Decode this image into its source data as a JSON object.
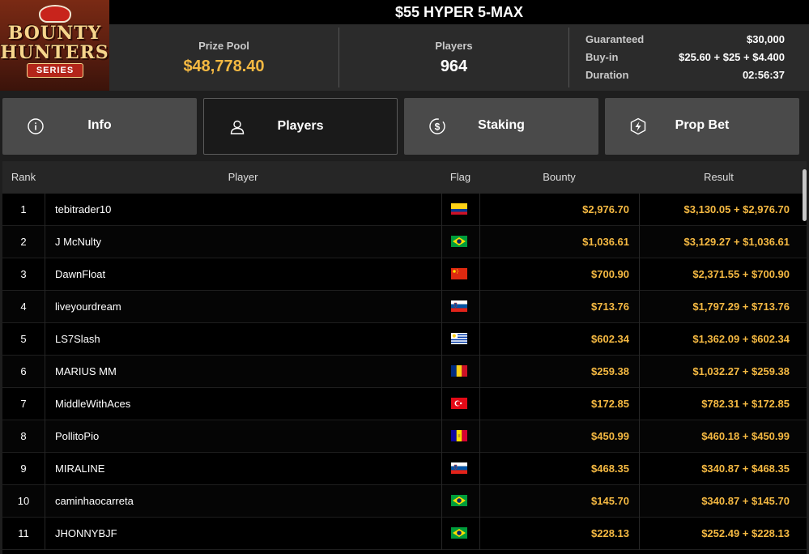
{
  "logo": {
    "line1": "BOUNTY",
    "line2": "HUNTERS",
    "line3": "SERIES"
  },
  "title": "$55 HYPER 5-MAX",
  "stats": {
    "prize_pool_label": "Prize Pool",
    "prize_pool_value": "$48,778.40",
    "players_label": "Players",
    "players_value": "964",
    "guaranteed_label": "Guaranteed",
    "guaranteed_value": "$30,000",
    "buyin_label": "Buy-in",
    "buyin_value": "$25.60 + $25 + $4.400",
    "duration_label": "Duration",
    "duration_value": "02:56:37"
  },
  "tabs": [
    {
      "label": "Info",
      "icon": "info-icon"
    },
    {
      "label": "Players",
      "icon": "user-icon",
      "active": true
    },
    {
      "label": "Staking",
      "icon": "dollar-coin-icon"
    },
    {
      "label": "Prop Bet",
      "icon": "lightning-badge-icon"
    }
  ],
  "table": {
    "headers": {
      "rank": "Rank",
      "player": "Player",
      "flag": "Flag",
      "bounty": "Bounty",
      "result": "Result"
    },
    "rows": [
      {
        "rank": "1",
        "player": "tebitrader10",
        "flag": "colombia",
        "bounty": "$2,976.70",
        "result": "$3,130.05 + $2,976.70"
      },
      {
        "rank": "2",
        "player": "J McNulty",
        "flag": "brazil",
        "bounty": "$1,036.61",
        "result": "$3,129.27 + $1,036.61"
      },
      {
        "rank": "3",
        "player": "DawnFloat",
        "flag": "china",
        "bounty": "$700.90",
        "result": "$2,371.55 + $700.90"
      },
      {
        "rank": "4",
        "player": "liveyourdream",
        "flag": "slovenia",
        "bounty": "$713.76",
        "result": "$1,797.29 + $713.76"
      },
      {
        "rank": "5",
        "player": "LS7Slash",
        "flag": "uruguay",
        "bounty": "$602.34",
        "result": "$1,362.09 + $602.34"
      },
      {
        "rank": "6",
        "player": "MARIUS MM",
        "flag": "romania",
        "bounty": "$259.38",
        "result": "$1,032.27 + $259.38"
      },
      {
        "rank": "7",
        "player": "MiddleWithAces",
        "flag": "turkey",
        "bounty": "$172.85",
        "result": "$782.31 + $172.85"
      },
      {
        "rank": "8",
        "player": "PollitoPio",
        "flag": "andorra",
        "bounty": "$450.99",
        "result": "$460.18 + $450.99"
      },
      {
        "rank": "9",
        "player": "MIRALINE",
        "flag": "slovenia",
        "bounty": "$468.35",
        "result": "$340.87 + $468.35"
      },
      {
        "rank": "10",
        "player": "caminhaocarreta",
        "flag": "brazil",
        "bounty": "$145.70",
        "result": "$340.87 + $145.70"
      },
      {
        "rank": "11",
        "player": "JHONNYBJF",
        "flag": "brazil",
        "bounty": "$228.13",
        "result": "$252.49 + $228.13"
      }
    ]
  },
  "colors": {
    "accent_gold": "#f5b942",
    "active_tab_bg": "#1a1a1a",
    "tab_bg": "#4a4a4a"
  }
}
